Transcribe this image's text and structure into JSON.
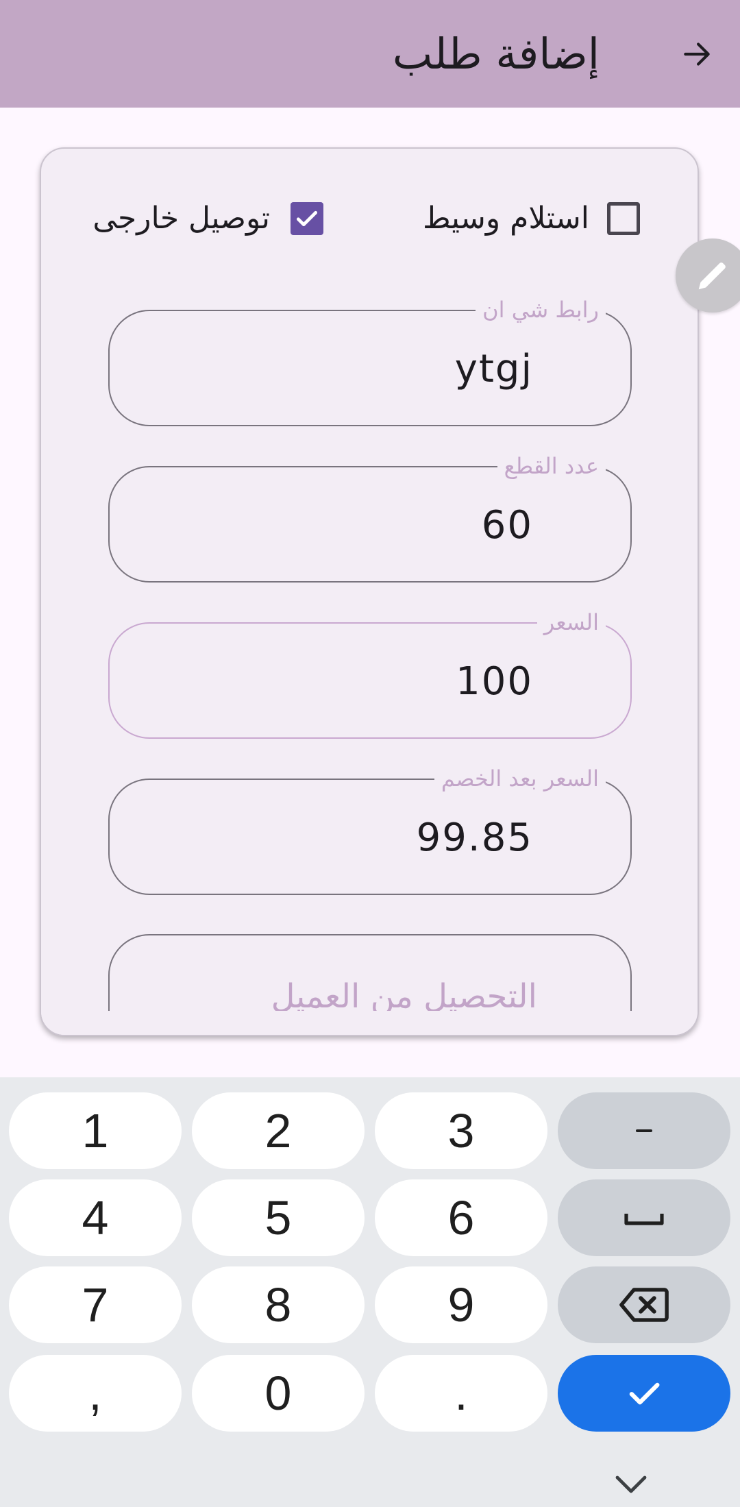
{
  "appbar": {
    "title": "إضافة طلب",
    "back_icon": "arrow-right-icon"
  },
  "checkboxes": {
    "receive_via_agent": {
      "label": "استلام وسيط",
      "checked": false
    },
    "external_delivery": {
      "label": "توصيل خارجى",
      "checked": true
    }
  },
  "fields": {
    "shein_link": {
      "label": "رابط شي ان",
      "value": "ytgj"
    },
    "pieces_count": {
      "label": "عدد القطع",
      "value": "60"
    },
    "price": {
      "label": "السعر",
      "value": "100"
    },
    "price_after_discount": {
      "label": "السعر بعد الخصم",
      "value": "99.85"
    },
    "collect_from_customer": {
      "placeholder": "التحصيل من العميل"
    }
  },
  "fab": {
    "icon": "pencil-icon"
  },
  "keyboard": {
    "rows": [
      [
        "1",
        "2",
        "3",
        "-"
      ],
      [
        "4",
        "5",
        "6",
        "␣"
      ],
      [
        "7",
        "8",
        "9",
        "⌫"
      ],
      [
        ",",
        "0",
        ".",
        "✓"
      ]
    ],
    "hide_icon": "chevron-down-icon"
  },
  "colors": {
    "appbar": "#c2a7c5",
    "checkbox_checked": "#6750a4",
    "done_key": "#1b73e8"
  }
}
